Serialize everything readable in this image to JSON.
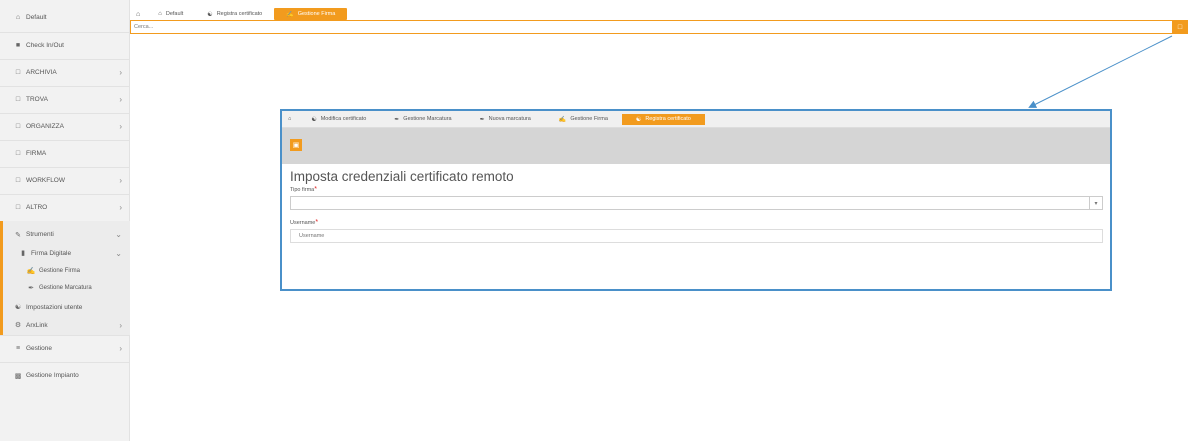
{
  "sidebar": {
    "items": [
      {
        "label": "Default",
        "icon": "home-icon"
      },
      {
        "label": "Check In/Out",
        "icon": "square-icon"
      },
      {
        "label": "ARCHIVIA",
        "icon": "folder-icon"
      },
      {
        "label": "TROVA",
        "icon": "folder-icon"
      },
      {
        "label": "ORGANIZZA",
        "icon": "folder-icon"
      },
      {
        "label": "FIRMA",
        "icon": "folder-icon"
      },
      {
        "label": "WORKFLOW",
        "icon": "folder-icon"
      },
      {
        "label": "ALTRO",
        "icon": "folder-icon"
      },
      {
        "label": "Strumenti",
        "icon": "wrench-icon"
      },
      {
        "label": "Firma Digitale",
        "icon": "document-icon"
      },
      {
        "label": "Gestione Firma",
        "icon": "sign-icon"
      },
      {
        "label": "Gestione Marcatura",
        "icon": "pen-icon"
      },
      {
        "label": "Impostazioni utente",
        "icon": "users-icon"
      },
      {
        "label": "ArxLink",
        "icon": "gear-icon"
      },
      {
        "label": "Gestione",
        "icon": "sliders-icon"
      },
      {
        "label": "Gestione Impianto",
        "icon": "chart-icon"
      }
    ]
  },
  "top_tabs": {
    "home_icon": "home-icon",
    "tabs": [
      {
        "label": "Default"
      },
      {
        "label": "Registra certificato"
      },
      {
        "label": "Gestione Firma"
      }
    ]
  },
  "search": {
    "placeholder": "Cerca..."
  },
  "panel": {
    "tabs": [
      {
        "label": "Modifica certificato"
      },
      {
        "label": "Gestione Marcatura"
      },
      {
        "label": "Nuova marcatura"
      },
      {
        "label": "Gestione Firma"
      },
      {
        "label": "Registra certificato"
      }
    ],
    "title": "Imposta credenziali certificato remoto",
    "tipo_firma_label": "Tipo firma",
    "tipo_firma_value": "",
    "username_label": "Username",
    "username_placeholder": "Username",
    "required_mark": "*"
  },
  "colors": {
    "accent": "#f29b1e",
    "panel_border": "#4a90c9",
    "required": "#e01b1b"
  }
}
